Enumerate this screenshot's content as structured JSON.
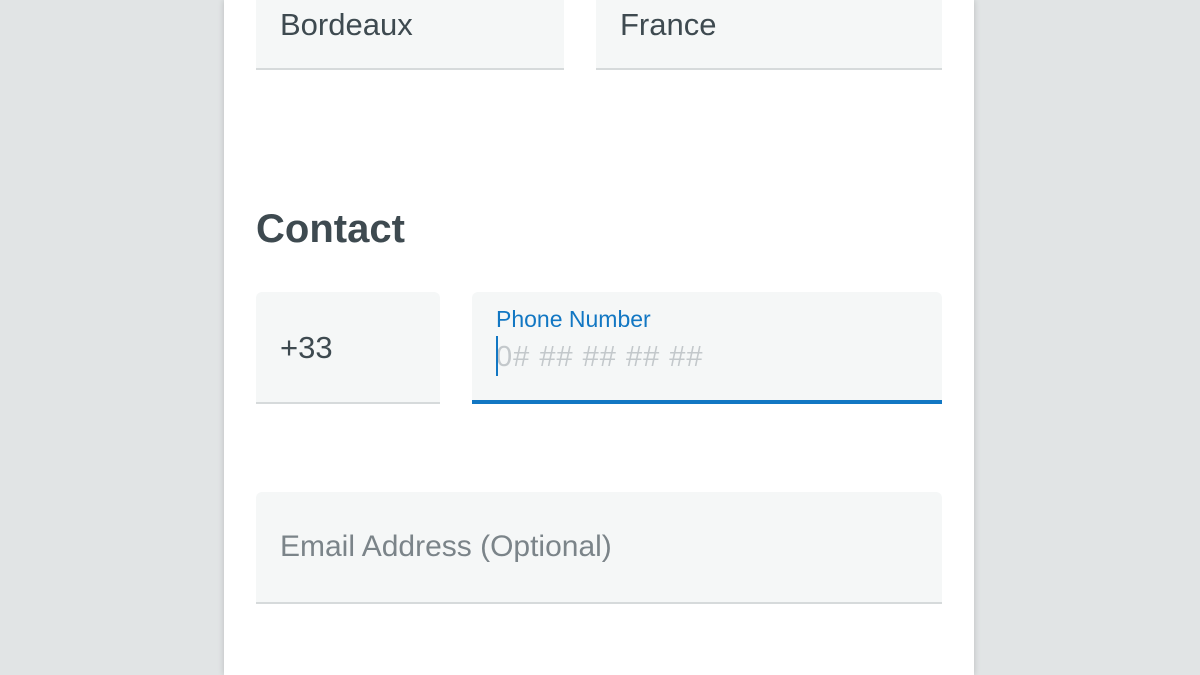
{
  "address": {
    "city_value": "Bordeaux",
    "country_value": "France"
  },
  "contact": {
    "section_title": "Contact",
    "dial_code_value": "+33",
    "phone_label": "Phone Number",
    "phone_mask": "0# ## ## ## ##",
    "email_placeholder": "Email Address (Optional)"
  },
  "colors": {
    "page_background": "#e1e4e5",
    "card_background": "#ffffff",
    "field_background": "#f5f7f7",
    "accent": "#1277c3",
    "text": "#3e4a50",
    "placeholder": "#7b8489"
  }
}
